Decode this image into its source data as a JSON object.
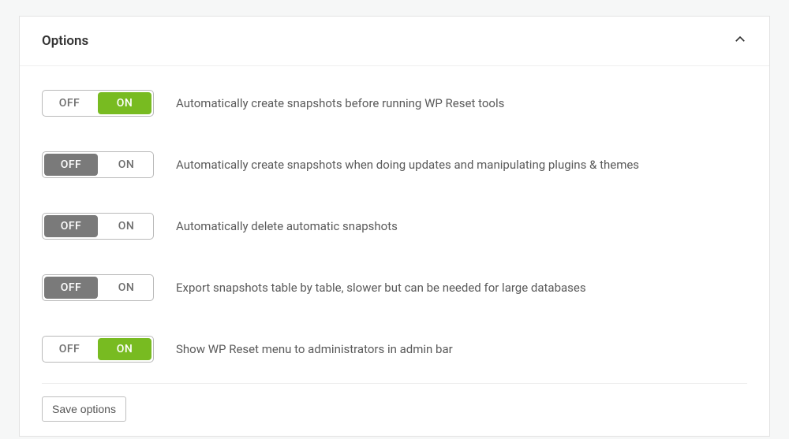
{
  "panel": {
    "title": "Options",
    "toggle_labels": {
      "off": "OFF",
      "on": "ON"
    },
    "options": [
      {
        "state": "on",
        "label": "Automatically create snapshots before running WP Reset tools"
      },
      {
        "state": "off",
        "label": "Automatically create snapshots when doing updates and manipulating plugins & themes"
      },
      {
        "state": "off",
        "label": "Automatically delete automatic snapshots"
      },
      {
        "state": "off",
        "label": "Export snapshots table by table, slower but can be needed for large databases"
      },
      {
        "state": "on",
        "label": "Show WP Reset menu to administrators in admin bar"
      }
    ],
    "save_button": "Save options"
  }
}
